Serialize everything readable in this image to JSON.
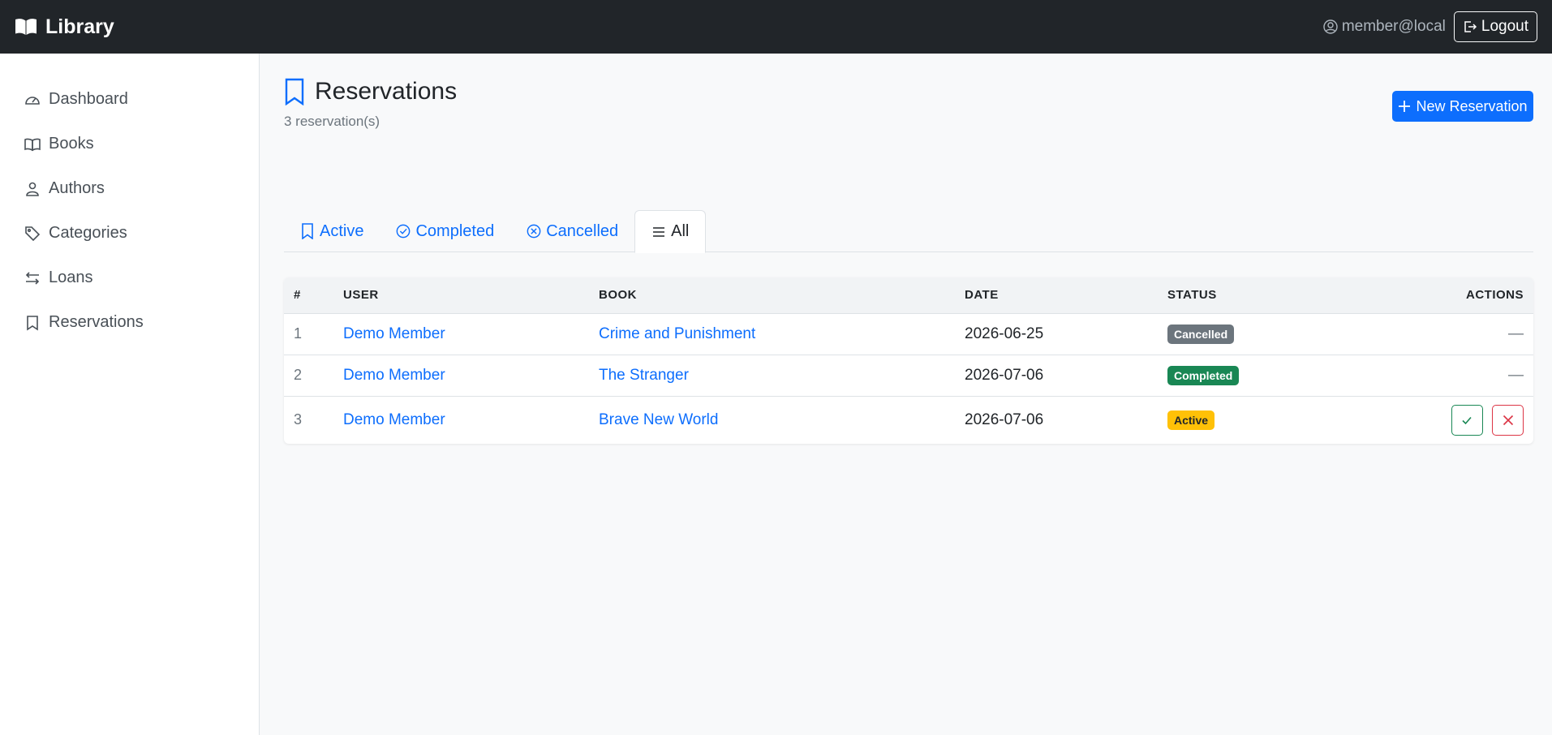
{
  "navbar": {
    "brand": "Library",
    "user_email": "member@local",
    "logout_label": "Logout"
  },
  "sidebar": {
    "items": [
      {
        "label": "Dashboard",
        "icon": "speedometer-icon"
      },
      {
        "label": "Books",
        "icon": "book-icon"
      },
      {
        "label": "Authors",
        "icon": "person-icon"
      },
      {
        "label": "Categories",
        "icon": "tag-icon"
      },
      {
        "label": "Loans",
        "icon": "arrows-icon"
      },
      {
        "label": "Reservations",
        "icon": "bookmark-icon"
      }
    ]
  },
  "page": {
    "title": "Reservations",
    "subtitle": "3 reservation(s)",
    "new_button": "New Reservation"
  },
  "tabs": [
    {
      "label": "Active",
      "icon": "bookmark-icon"
    },
    {
      "label": "Completed",
      "icon": "check-circle-icon"
    },
    {
      "label": "Cancelled",
      "icon": "x-circle-icon"
    },
    {
      "label": "All",
      "icon": "list-icon",
      "active": true
    }
  ],
  "table": {
    "headers": [
      "#",
      "USER",
      "BOOK",
      "DATE",
      "STATUS",
      "ACTIONS"
    ],
    "rows": [
      {
        "num": "1",
        "user": "Demo Member",
        "book": "Crime and Punishment",
        "date": "2026-06-25",
        "status": "Cancelled",
        "actions": "—"
      },
      {
        "num": "2",
        "user": "Demo Member",
        "book": "The Stranger",
        "date": "2026-07-06",
        "status": "Completed",
        "actions": "—"
      },
      {
        "num": "3",
        "user": "Demo Member",
        "book": "Brave New World",
        "date": "2026-07-06",
        "status": "Active",
        "actions": ""
      }
    ]
  },
  "colors": {
    "primary": "#0d6efd",
    "navbar": "#212529",
    "cancelled": "#6c757d",
    "completed": "#198754",
    "active": "#ffc107",
    "danger": "#dc3545"
  }
}
